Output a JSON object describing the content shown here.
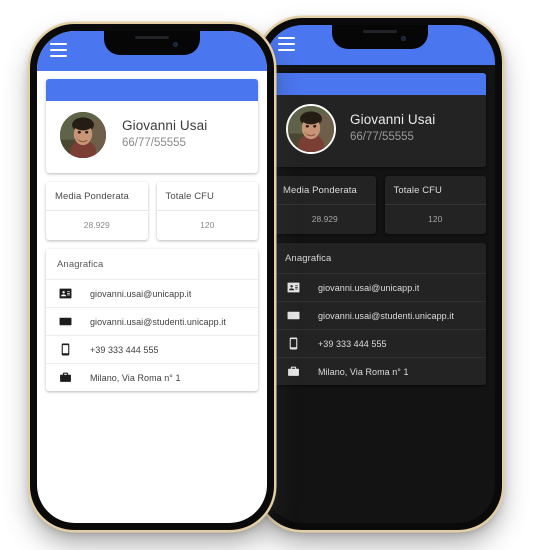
{
  "theme": {
    "accent": "#4a76ef",
    "light_background": "#ffffff",
    "dark_background": "#131313",
    "dark_card": "#232323",
    "page_background": "#ffffff"
  },
  "appbar": {
    "menu_icon": "hamburger-menu-icon"
  },
  "profile": {
    "name": "Giovanni Usai",
    "identifier": "66/77/55555",
    "avatar_icon": "user-photo-avatar"
  },
  "stats": [
    {
      "label": "Media Ponderata",
      "value": "28.929"
    },
    {
      "label": "Totale CFU",
      "value": "120"
    }
  ],
  "anagrafica": {
    "section_title": "Anagrafica",
    "rows": [
      {
        "icon": "id-badge-icon",
        "value": "giovanni.usai@unicapp.it"
      },
      {
        "icon": "envelope-icon",
        "value": "giovanni.usai@studenti.unicapp.it"
      },
      {
        "icon": "smartphone-icon",
        "value": "+39 333 444 555"
      },
      {
        "icon": "briefcase-icon",
        "value": "Milano, Via Roma n° 1"
      }
    ]
  },
  "devices": [
    {
      "name": "phone-dark-theme",
      "theme": "dark"
    },
    {
      "name": "phone-light-theme",
      "theme": "light"
    }
  ]
}
